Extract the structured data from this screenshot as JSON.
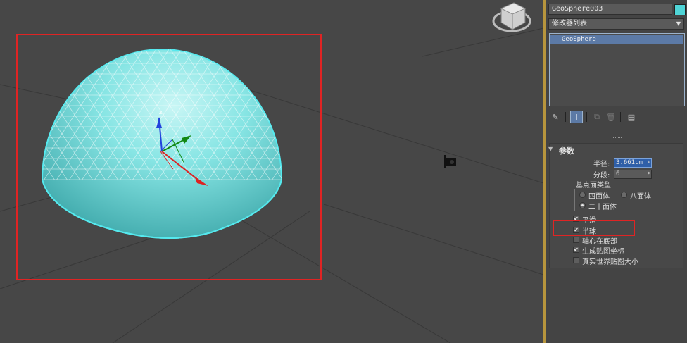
{
  "object_name": "GeoSphere003",
  "object_color": "#4fd4d6",
  "modifier_list_label": "修改器列表",
  "stack": {
    "items": [
      {
        "label": "GeoSphere"
      }
    ]
  },
  "toolbar": {
    "icons": [
      "pin-stack-icon",
      "show-end-result-icon",
      "make-unique-icon",
      "remove-modifier-icon",
      "configure-modifier-sets-icon"
    ]
  },
  "parameters": {
    "rollout_title": "参数",
    "radius_label": "半径:",
    "radius_value": "3.661cm",
    "segments_label": "分段:",
    "segments_value": "6",
    "base_type_label": "基点面类型",
    "base_type_options": [
      "四面体",
      "八面体",
      "二十面体"
    ],
    "base_type_selected": "二十面体",
    "smooth_label": "平滑",
    "smooth_checked": true,
    "hemisphere_label": "半球",
    "hemisphere_checked": true,
    "base_to_pivot_label": "轴心在底部",
    "base_to_pivot_checked": false,
    "gen_map_coords_label": "生成贴图坐标",
    "gen_map_coords_checked": true,
    "real_world_map_size_label": "真实世界贴图大小",
    "real_world_map_size_checked": false
  },
  "colors": {
    "highlight": "#e02424",
    "sphere": "#7fe3e3",
    "accent": "#b7953d"
  }
}
